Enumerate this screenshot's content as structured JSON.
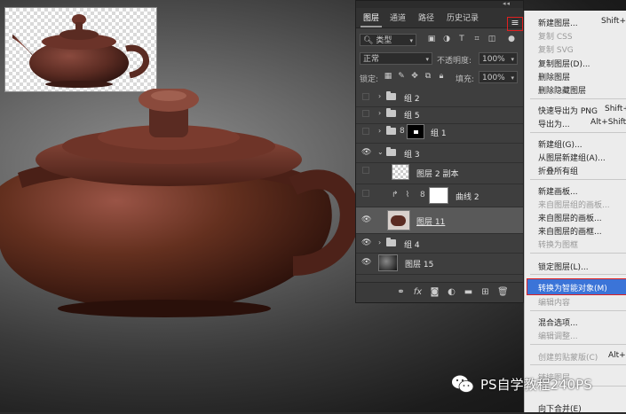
{
  "layers_panel": {
    "tabs": [
      "图层",
      "通道",
      "路径",
      "历史记录"
    ],
    "filter_select": "类型",
    "blend_mode": "正常",
    "opacity_label": "不透明度:",
    "opacity_value": "100%",
    "lock_label": "锁定:",
    "fill_label": "填充:",
    "fill_value": "100%",
    "layers": [
      {
        "name": "组 2"
      },
      {
        "name": "组 5"
      },
      {
        "name": "组 1"
      },
      {
        "name": "组 3"
      },
      {
        "name": "图层 2 副本"
      },
      {
        "name": "曲线 2"
      },
      {
        "name": "图层 11"
      },
      {
        "name": "组 4"
      },
      {
        "name": "图层 15"
      }
    ],
    "bottom_icons": [
      "link-icon",
      "fx-icon",
      "mask-icon",
      "adjustment-icon",
      "folder-icon",
      "new-layer-icon",
      "trash-icon"
    ]
  },
  "context_menu": {
    "items": [
      {
        "label": "新建图层...",
        "shortcut": "Shift+"
      },
      {
        "label": "复制 CSS"
      },
      {
        "label": "复制 SVG"
      },
      {
        "label": "复制图层(D)..."
      },
      {
        "label": "删除图层"
      },
      {
        "label": "删除隐藏图层"
      },
      {
        "label": "快速导出为 PNG",
        "shortcut": "Shift+"
      },
      {
        "label": "导出为...",
        "shortcut": "Alt+Shift+"
      },
      {
        "label": "新建组(G)..."
      },
      {
        "label": "从图层新建组(A)..."
      },
      {
        "label": "折叠所有组"
      },
      {
        "label": "新建画板..."
      },
      {
        "label": "来自图层组的画板..."
      },
      {
        "label": "来自图层的画板..."
      },
      {
        "label": "来自图层的画框..."
      },
      {
        "label": "转换为图框"
      },
      {
        "label": "锁定图层(L)..."
      },
      {
        "label": "转换为智能对象(M)"
      },
      {
        "label": "编辑内容"
      },
      {
        "label": "混合选项..."
      },
      {
        "label": "编辑调整..."
      },
      {
        "label": "创建剪贴蒙版(C)",
        "shortcut": "Alt+("
      },
      {
        "label": "链接图层"
      },
      {
        "label": "向下合并(E)"
      }
    ]
  },
  "watermark": "PS自学教程240PS",
  "colors": {
    "highlight": "#3b74d8",
    "callout": "#e02020",
    "teapot": "#5a2b22"
  }
}
